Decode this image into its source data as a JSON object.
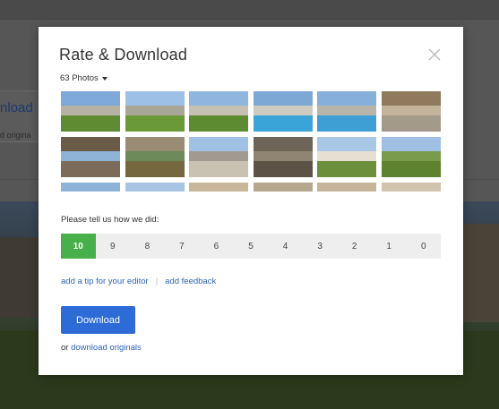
{
  "background": {
    "download_fragment": "nload",
    "originals_fragment": "d origina"
  },
  "modal": {
    "title": "Rate & Download",
    "close_label": "×"
  },
  "photos": {
    "count_label": "63 Photos",
    "thumbnails": [
      {
        "sky": "#7ea9d8",
        "mid": "#b8b2a4",
        "gnd": "#5f8c33"
      },
      {
        "sky": "#9dc0e6",
        "mid": "#a9a597",
        "gnd": "#6a9a38"
      },
      {
        "sky": "#8fb6de",
        "mid": "#c6c0b2",
        "gnd": "#5d8b31"
      },
      {
        "sky": "#7da7d4",
        "mid": "#cfcac0",
        "gnd": "#3aa4d8"
      },
      {
        "sky": "#86afdb",
        "mid": "#b9b4aa",
        "gnd": "#3d9fd3"
      },
      {
        "sky": "#8f7a5e",
        "mid": "#c2b39a",
        "gnd": "#a49a8a"
      },
      {
        "sky": "#6a5a48",
        "mid": "#8fb3d6",
        "gnd": "#7c6b58"
      },
      {
        "sky": "#9a8b74",
        "mid": "#6d8a5a",
        "gnd": "#75683f"
      },
      {
        "sky": "#9fc2e4",
        "mid": "#a09a90",
        "gnd": "#c9c2b2"
      },
      {
        "sky": "#6e6558",
        "mid": "#908472",
        "gnd": "#5c5246"
      },
      {
        "sky": "#a9c8e6",
        "mid": "#e6e0d2",
        "gnd": "#6c8f3c"
      },
      {
        "sky": "#9fc0e2",
        "mid": "#7a9a4c",
        "gnd": "#5e8330"
      },
      {
        "sky": "#8fb3d8",
        "mid": "#b2aca0",
        "gnd": "#a8a092"
      },
      {
        "sky": "#a7c4e2",
        "mid": "#8e8778",
        "gnd": "#a69a84"
      },
      {
        "sky": "#c9b79c",
        "mid": "#b4a488",
        "gnd": "#cfc4b0"
      },
      {
        "sky": "#b6a88e",
        "mid": "#c8bca6",
        "gnd": "#d2c8b6"
      },
      {
        "sky": "#c4b49a",
        "mid": "#d4c8b2",
        "gnd": "#c8bca4"
      },
      {
        "sky": "#d0c4ae",
        "mid": "#bfb29a",
        "gnd": "#dcd2c0"
      }
    ]
  },
  "rating": {
    "prompt": "Please tell us how we did:",
    "options": [
      "10",
      "9",
      "8",
      "7",
      "6",
      "5",
      "4",
      "3",
      "2",
      "1",
      "0"
    ],
    "selected": "10"
  },
  "links": {
    "tip": "add a tip for your editor",
    "separator": "|",
    "feedback": "add feedback"
  },
  "download": {
    "button_label": "Download",
    "or_prefix": "or",
    "originals_link": "download originals"
  },
  "colors": {
    "accent": "#2d6bd6",
    "selected_rating": "#48b04a",
    "link": "#2f63b9"
  }
}
